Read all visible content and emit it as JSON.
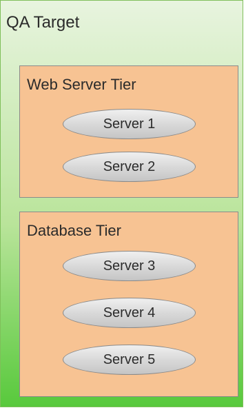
{
  "target": {
    "title": "QA Target"
  },
  "tiers": [
    {
      "title": "Web Server Tier",
      "servers": [
        "Server 1",
        "Server 2"
      ]
    },
    {
      "title": "Database Tier",
      "servers": [
        "Server 3",
        "Server 4",
        "Server 5"
      ]
    }
  ]
}
